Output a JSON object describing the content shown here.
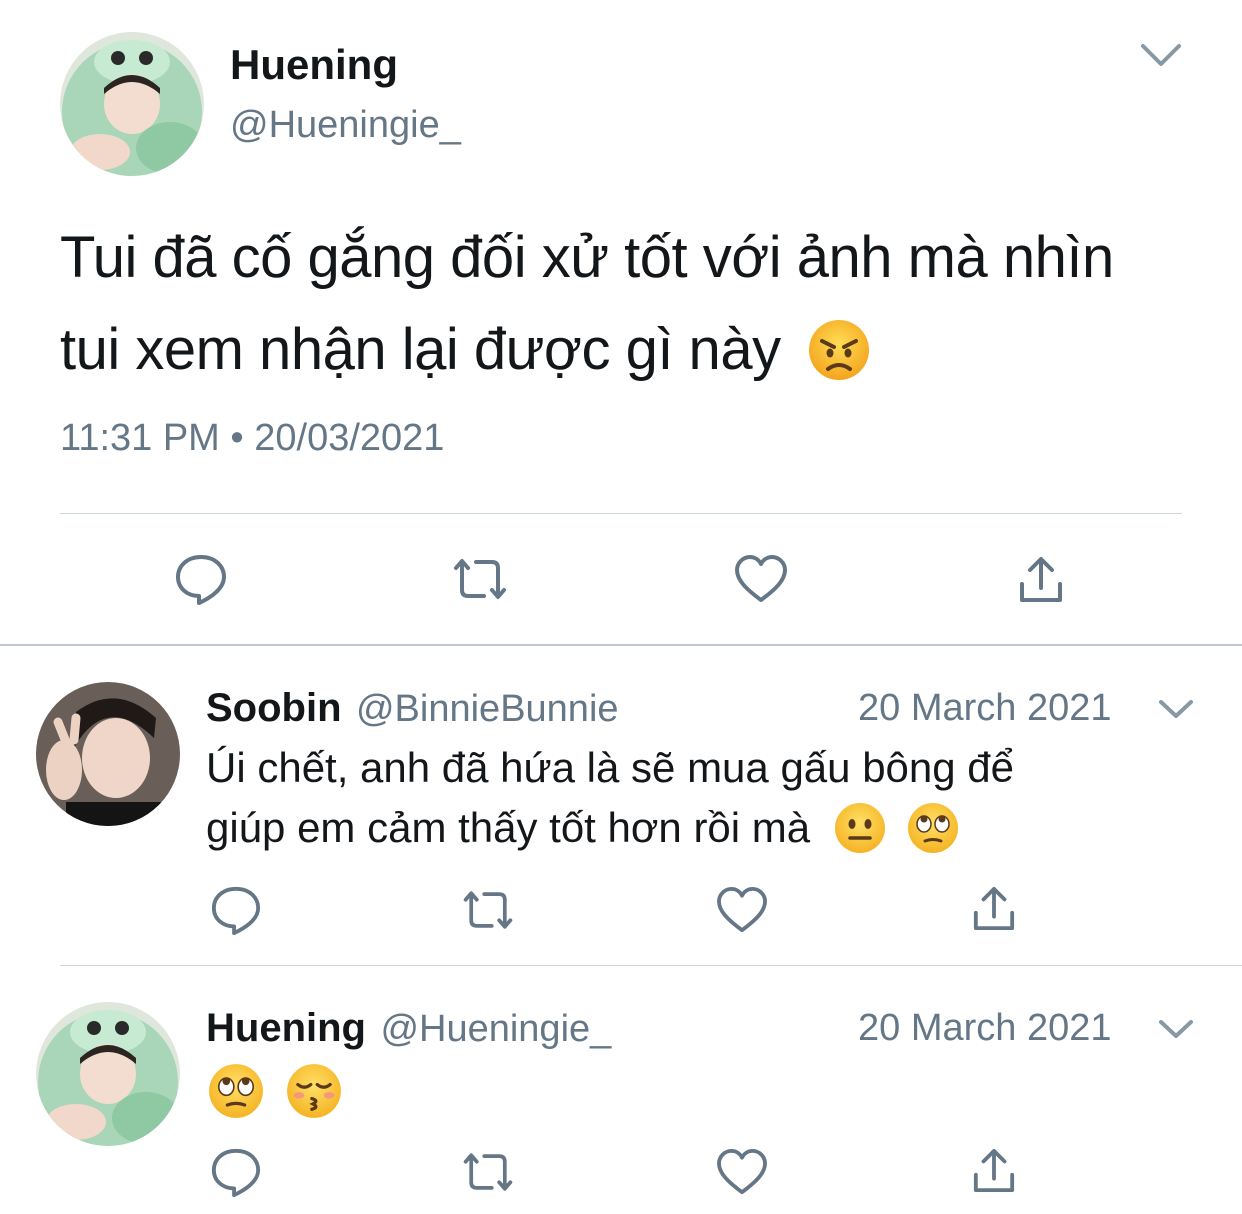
{
  "main_tweet": {
    "author_name": "Huening",
    "author_handle": "@Hueningie_",
    "text_line1": "Tui đã cố gắng đối xử tốt với ảnh mà nhìn",
    "text_line2": "tui xem nhận lại được gì này",
    "text_emoji": "angry-face",
    "timestamp": "11:31 PM • 20/03/2021",
    "menu_icon": "chevron-down-icon",
    "actions": [
      "reply-icon",
      "retweet-icon",
      "like-icon",
      "share-icon"
    ]
  },
  "replies": [
    {
      "author_name": "Soobin",
      "author_handle": "@BinnieBunnie",
      "date": "20 March 2021",
      "text_line1": "Úi chết, anh đã hứa là sẽ mua gấu bông để",
      "text_line2": "giúp em cảm thấy tốt hơn rồi mà",
      "emojis": [
        "neutral-face",
        "rolling-eyes-face"
      ]
    },
    {
      "author_name": "Huening",
      "author_handle": "@Hueningie_",
      "date": "20 March 2021",
      "emojis": [
        "rolling-eyes-face",
        "kissing-closed-eyes-face"
      ]
    }
  ],
  "colors": {
    "primary_text": "#14171a",
    "secondary_text": "#657786",
    "divider": "#ccd6dd",
    "icon": "#657786",
    "emoji_yellow": "#ffcc33"
  }
}
